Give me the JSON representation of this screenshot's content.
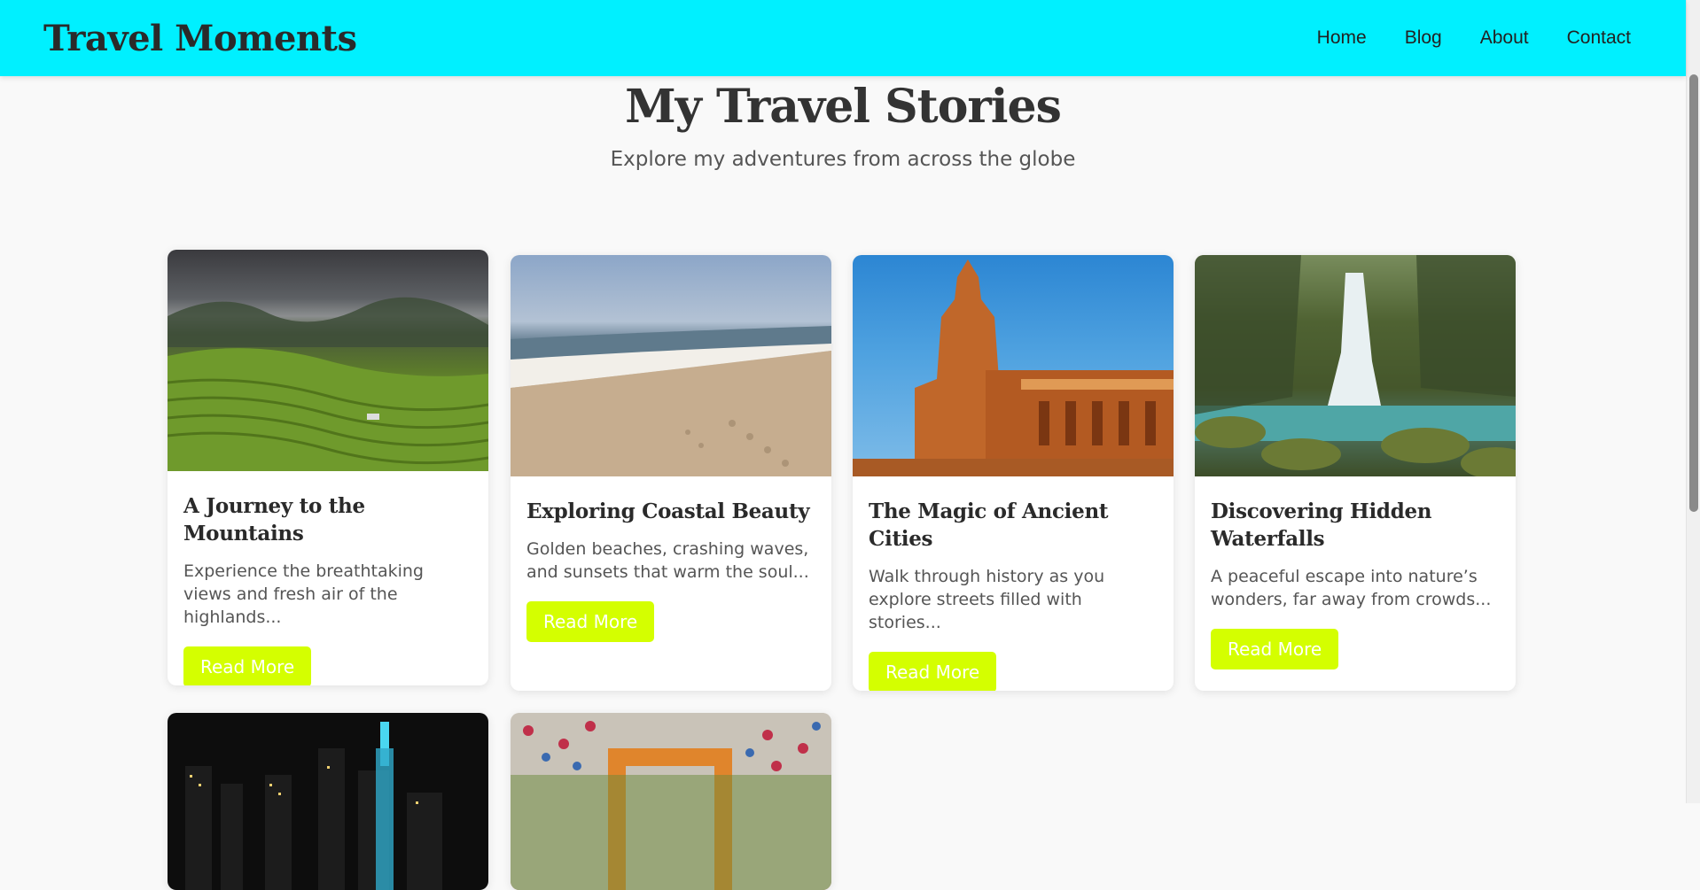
{
  "header": {
    "site_title": "Travel Moments",
    "nav": [
      "Home",
      "Blog",
      "About",
      "Contact"
    ]
  },
  "hero": {
    "title": "My Travel Stories",
    "subtitle": "Explore my adventures from across the globe"
  },
  "cards": [
    {
      "title": "A Journey to the Mountains",
      "excerpt": "Experience the breathtaking views and fresh air of the highlands...",
      "button": "Read More",
      "image": "mountains-terraces-photo"
    },
    {
      "title": "Exploring Coastal Beauty",
      "excerpt": "Golden beaches, crashing waves, and sunsets that warm the soul...",
      "button": "Read More",
      "image": "beach-shore-photo"
    },
    {
      "title": "The Magic of Ancient Cities",
      "excerpt": "Walk through history as you explore streets filled with stories...",
      "button": "Read More",
      "image": "ancient-temple-photo"
    },
    {
      "title": "Discovering Hidden Waterfalls",
      "excerpt": "A peaceful escape into nature’s wonders, far away from crowds...",
      "button": "Read More",
      "image": "waterfall-photo"
    },
    {
      "image": "city-night-skyline-photo"
    },
    {
      "image": "festival-decorations-photo"
    }
  ],
  "colors": {
    "header_bg": "#00f0ff",
    "button_bg": "#d4ff00",
    "page_bg": "#f9f9f9"
  }
}
